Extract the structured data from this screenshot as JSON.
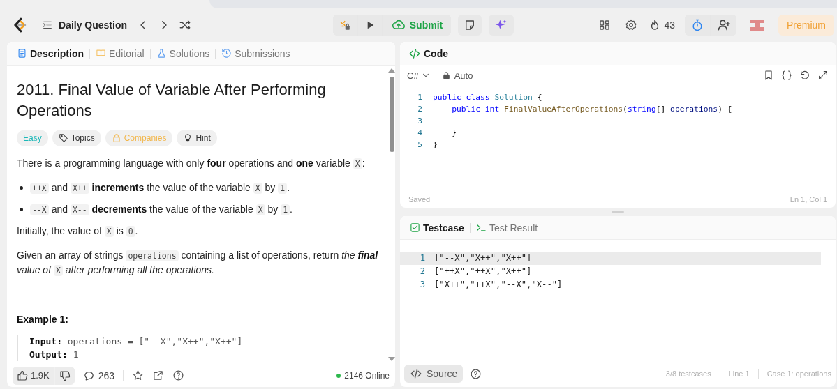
{
  "header": {
    "title": "Daily Question",
    "submit": "Submit",
    "streak": "43",
    "premium": "Premium"
  },
  "left_tabs": [
    {
      "label": "Description",
      "kind": "description",
      "selected": true
    },
    {
      "label": "Editorial",
      "kind": "editorial",
      "selected": false
    },
    {
      "label": "Solutions",
      "kind": "solutions",
      "selected": false
    },
    {
      "label": "Submissions",
      "kind": "submissions",
      "selected": false
    }
  ],
  "problem": {
    "title": "2011. Final Value of Variable After Performing Operations",
    "tags": [
      {
        "label": "Easy",
        "kind": "difficulty"
      },
      {
        "label": "Topics",
        "kind": "topics"
      },
      {
        "label": "Companies",
        "kind": "companies"
      },
      {
        "label": "Hint",
        "kind": "hint"
      }
    ],
    "blocks": [
      {
        "kind": "paragraph",
        "segments": [
          {
            "text": "There is a programming language with only ",
            "kind": "plain"
          },
          {
            "text": "four",
            "kind": "bold"
          },
          {
            "text": " operations and ",
            "kind": "plain"
          },
          {
            "text": "one",
            "kind": "bold"
          },
          {
            "text": " variable ",
            "kind": "plain"
          },
          {
            "text": "X",
            "kind": "code"
          },
          {
            "text": ":",
            "kind": "plain"
          }
        ]
      },
      {
        "kind": "bullet",
        "segments": [
          {
            "text": "++X",
            "kind": "code"
          },
          {
            "text": " and ",
            "kind": "plain"
          },
          {
            "text": "X++",
            "kind": "code"
          },
          {
            "text": " increments",
            "kind": "bold"
          },
          {
            "text": " the value of the variable ",
            "kind": "plain"
          },
          {
            "text": "X",
            "kind": "code"
          },
          {
            "text": " by ",
            "kind": "plain"
          },
          {
            "text": "1",
            "kind": "code"
          },
          {
            "text": ".",
            "kind": "plain"
          }
        ]
      },
      {
        "kind": "bullet",
        "segments": [
          {
            "text": "--X",
            "kind": "code"
          },
          {
            "text": " and ",
            "kind": "plain"
          },
          {
            "text": "X--",
            "kind": "code"
          },
          {
            "text": " decrements",
            "kind": "bold"
          },
          {
            "text": " the value of the variable ",
            "kind": "plain"
          },
          {
            "text": "X",
            "kind": "code"
          },
          {
            "text": " by ",
            "kind": "plain"
          },
          {
            "text": "1",
            "kind": "code"
          },
          {
            "text": ".",
            "kind": "plain"
          }
        ]
      },
      {
        "kind": "paragraph",
        "segments": [
          {
            "text": "Initially, the value of ",
            "kind": "plain"
          },
          {
            "text": "X",
            "kind": "code"
          },
          {
            "text": " is ",
            "kind": "plain"
          },
          {
            "text": "0",
            "kind": "code"
          },
          {
            "text": ".",
            "kind": "plain"
          }
        ]
      },
      {
        "kind": "paragraph",
        "segments": [
          {
            "text": "Given an array of strings ",
            "kind": "plain"
          },
          {
            "text": "operations",
            "kind": "code"
          },
          {
            "text": " containing a list of operations, return ",
            "kind": "plain"
          },
          {
            "text": "the ",
            "kind": "italic"
          },
          {
            "text": "final",
            "kind": "bold_italic"
          },
          {
            "text": " value of ",
            "kind": "italic"
          },
          {
            "text": "X",
            "kind": "code"
          },
          {
            "text": " after performing all the operations.",
            "kind": "italic"
          }
        ]
      }
    ],
    "example": {
      "heading": "Example 1:",
      "lines": [
        {
          "label": "Input:",
          "value": "operations = [\"--X\",\"X++\",\"X++\"]"
        },
        {
          "label": "Output:",
          "value": "1"
        }
      ]
    }
  },
  "left_footer": {
    "likes": "1.9K",
    "comments": "263",
    "online": "2146 Online"
  },
  "code": {
    "title": "Code",
    "language": "C#",
    "mode": "Auto",
    "lines": [
      {
        "num": "1",
        "tokens": [
          {
            "text": "public class ",
            "kind": "kw"
          },
          {
            "text": "Solution",
            "kind": "type"
          },
          {
            "text": " {",
            "kind": "plain"
          }
        ]
      },
      {
        "num": "2",
        "tokens": [
          {
            "text": "    public int ",
            "kind": "kw"
          },
          {
            "text": "FinalValueAfterOperations",
            "kind": "fn"
          },
          {
            "text": "(",
            "kind": "plain"
          },
          {
            "text": "string",
            "kind": "kw"
          },
          {
            "text": "[] ",
            "kind": "plain"
          },
          {
            "text": "operations",
            "kind": "param"
          },
          {
            "text": ") {",
            "kind": "plain"
          }
        ]
      },
      {
        "num": "3"
      },
      {
        "num": "4",
        "tokens": [
          {
            "text": "    }",
            "kind": "plain"
          }
        ]
      },
      {
        "num": "5",
        "tokens": [
          {
            "text": "}",
            "kind": "plain"
          }
        ]
      }
    ],
    "saved": "Saved",
    "cursor": "Ln 1, Col 1"
  },
  "testcase": {
    "tabs": [
      {
        "label": "Testcase",
        "kind": "testcase",
        "selected": true
      },
      {
        "label": "Test Result",
        "kind": "result",
        "selected": false
      }
    ],
    "cases": [
      {
        "num": "1",
        "text": "[\"--X\",\"X++\",\"X++\"]",
        "selected": true
      },
      {
        "num": "2",
        "text": "[\"++X\",\"++X\",\"X++\"]",
        "selected": false
      },
      {
        "num": "3",
        "text": "[\"X++\",\"++X\",\"--X\",\"X--\"]",
        "selected": false
      }
    ],
    "source": "Source",
    "stats": [
      "3/8 testcases",
      "Line 1",
      "Case 1: operations"
    ]
  }
}
